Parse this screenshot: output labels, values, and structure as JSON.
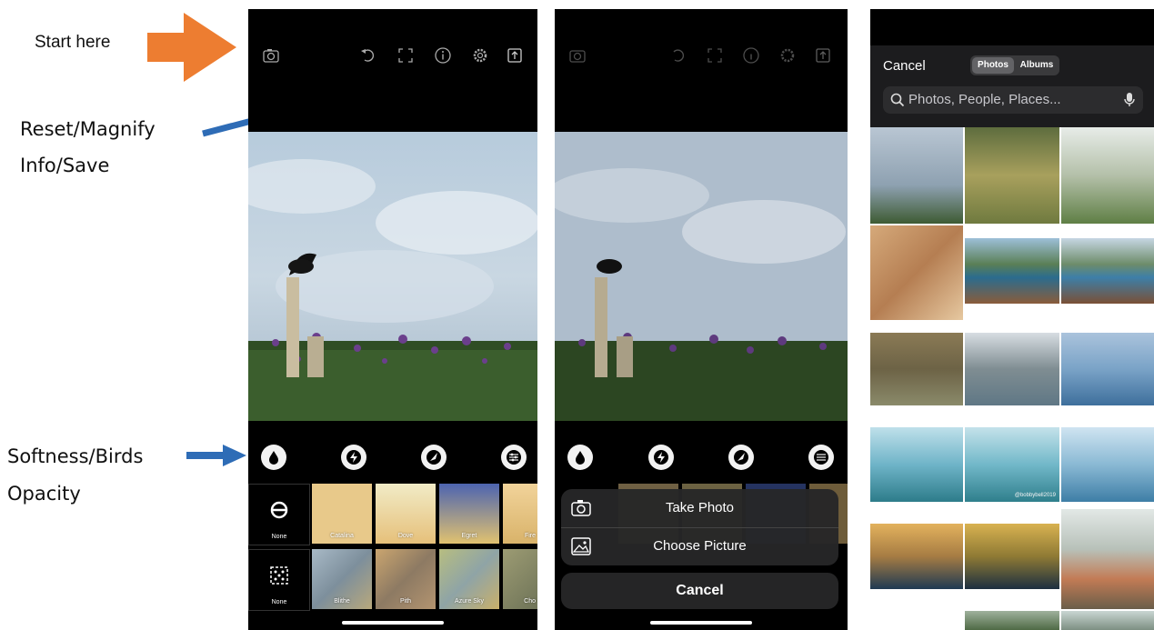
{
  "annotations": {
    "start_here": "Start here",
    "top_icons_line1": "Reset/Magnify",
    "top_icons_line2": "Info/Save",
    "tools_line1": "Softness/Birds",
    "tools_line2": "Opacity"
  },
  "icons": [
    "camera-icon",
    "reset-icon",
    "magnify-icon",
    "info-icon",
    "settings-icon",
    "share-save-icon",
    "softness-drop-icon",
    "lightning-icon",
    "bird-icon",
    "sliders-icon"
  ],
  "tiles_row1": [
    {
      "label": "None",
      "color": "#000000"
    },
    {
      "label": "Catalina",
      "color": "#e8c98a"
    },
    {
      "label": "Dove",
      "color": "#e6d3a3"
    },
    {
      "label": "Egret",
      "color": "#6f80b8"
    },
    {
      "label": "Fire",
      "color": "#d9b36a"
    }
  ],
  "tiles_row2": [
    {
      "label": "None",
      "color": "#000000"
    },
    {
      "label": "Blithe",
      "color": "#8fa2b3"
    },
    {
      "label": "Pith",
      "color": "#b3956a"
    },
    {
      "label": "Azure Sky",
      "color": "#a9b27a"
    },
    {
      "label": "Cho",
      "color": "#8b8e6a"
    }
  ],
  "action_sheet": {
    "take_photo": "Take Photo",
    "choose_picture": "Choose Picture",
    "cancel": "Cancel"
  },
  "picker": {
    "cancel": "Cancel",
    "tab_photos": "Photos",
    "tab_albums": "Albums",
    "search_placeholder": "Photos, People, Places...",
    "watermark": "@bobbybell2019"
  },
  "colors": {
    "arrow_orange": "#ed7d31",
    "arrow_blue": "#2e6cb6",
    "sheet_bg": "#262628"
  }
}
